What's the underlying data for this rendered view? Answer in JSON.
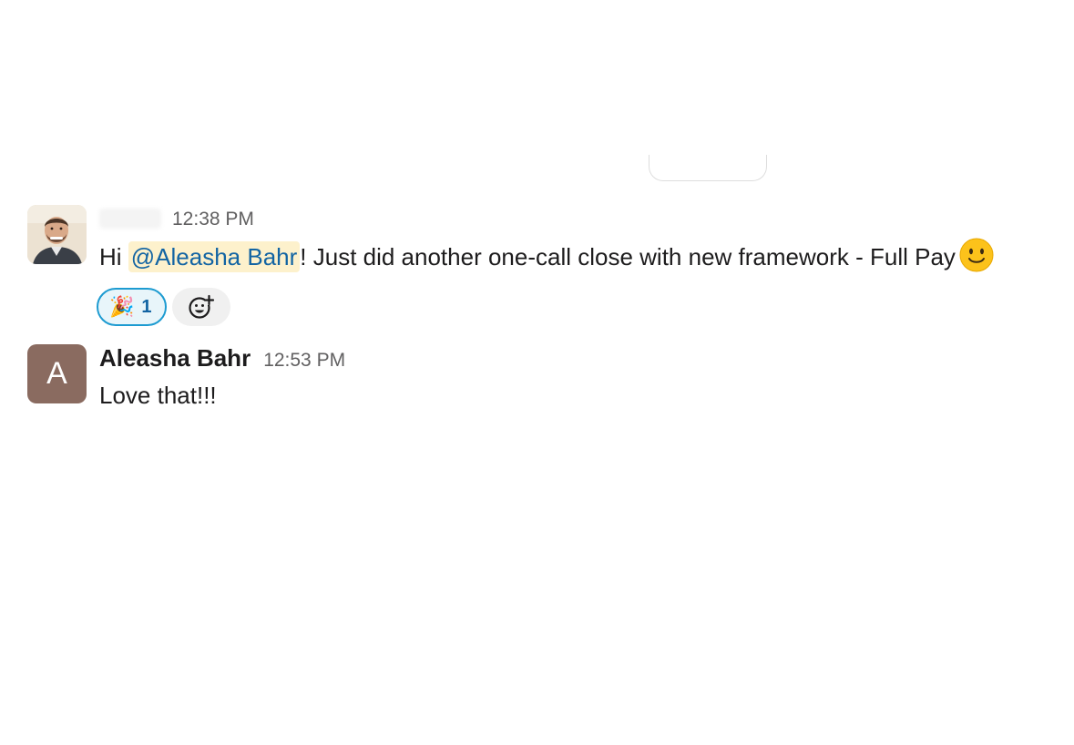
{
  "messages": [
    {
      "sender": "",
      "time": "12:38 PM",
      "text_before": "Hi ",
      "mention": "@Aleasha Bahr",
      "text_after": "! Just did another one-call close with new framework - Full Pay",
      "trailing_emoji": "slightly-smiling-face",
      "reactions": [
        {
          "emoji": "🎉",
          "emoji_name": "tada",
          "count": "1",
          "active": true
        }
      ]
    },
    {
      "sender": "Aleasha Bahr",
      "avatar_letter": "A",
      "time": "12:53 PM",
      "text": "Love that!!!"
    }
  ],
  "colors": {
    "mention_bg": "#fdf1cc",
    "mention_text": "#1264a3",
    "reaction_border": "#1d9bd1",
    "reaction_bg": "#e8f5fa",
    "avatar_letter_bg": "#8a6b60"
  },
  "icons": {
    "add_reaction": "add-reaction-icon",
    "smiley": "slightly-smiling-face-icon"
  }
}
